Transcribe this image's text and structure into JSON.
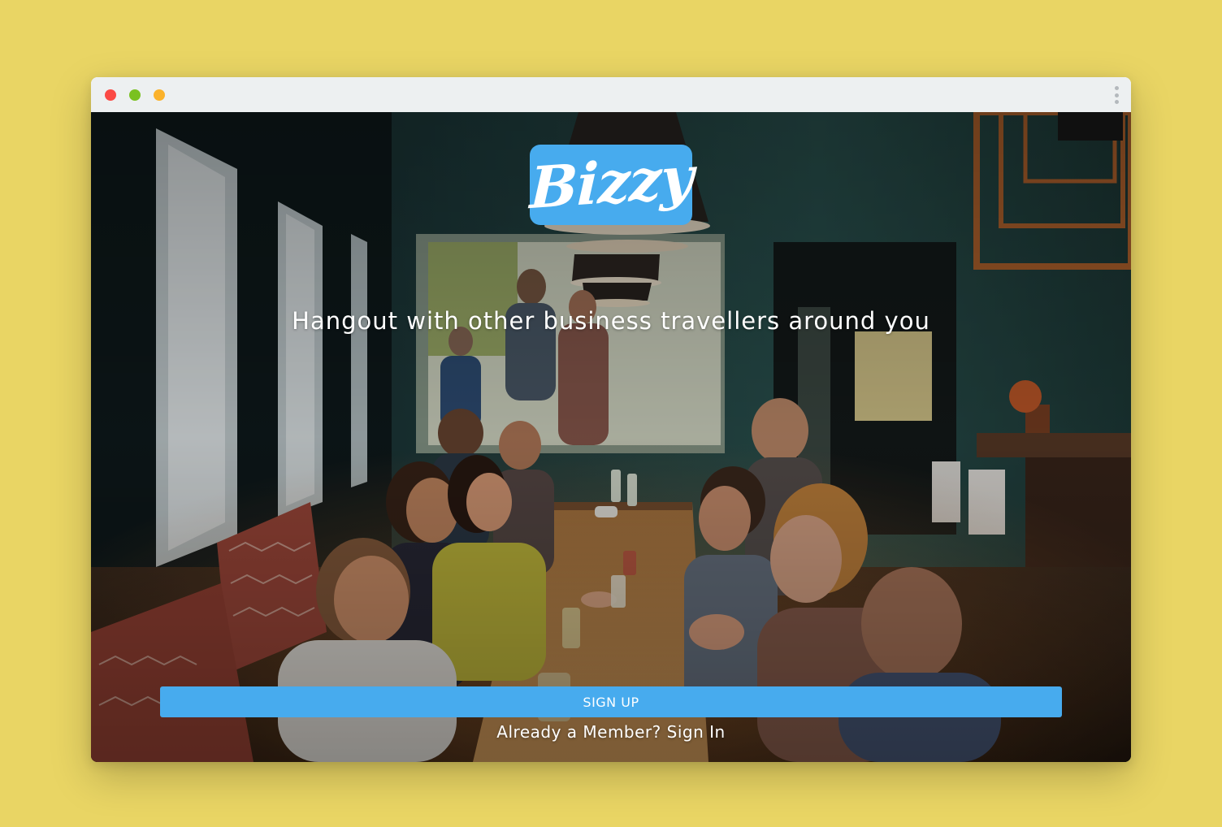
{
  "colors": {
    "background": "#e9d564",
    "accent": "#47abee",
    "traffic_red": "#fb4a45",
    "traffic_green": "#7ac120",
    "traffic_yellow": "#fbb22b"
  },
  "window": {
    "controls": [
      "close",
      "minimize",
      "maximize"
    ],
    "menu_icon": "kebab-menu-icon"
  },
  "logo": {
    "text": "Bizzy"
  },
  "hero": {
    "tagline": "Hangout with other business travellers around you",
    "background_image": "restaurant-crowd-photo"
  },
  "actions": {
    "signup_label": "SIGN UP",
    "signin_prompt": "Already a Member?",
    "signin_link": "Sign In"
  }
}
